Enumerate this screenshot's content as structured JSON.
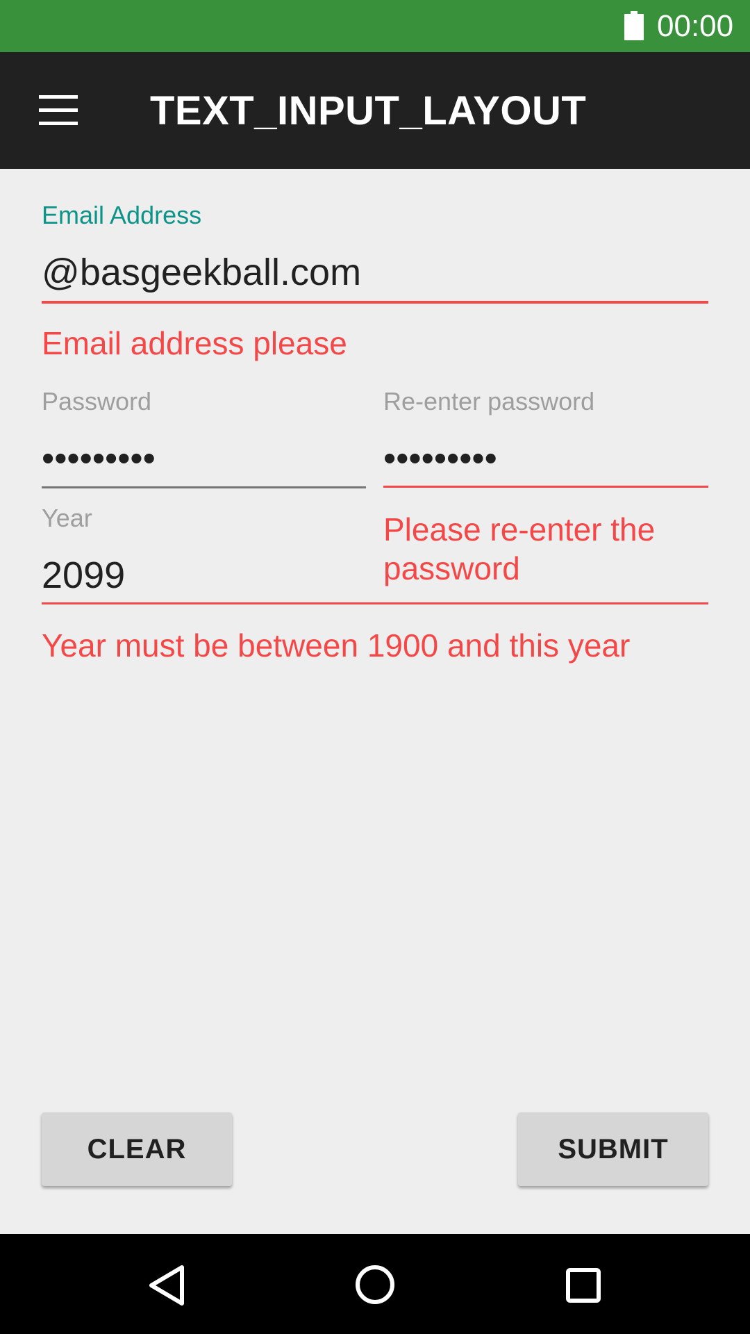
{
  "status_bar": {
    "time": "00:00",
    "battery_icon": "battery-full-icon",
    "color": "#3a913c"
  },
  "toolbar": {
    "title": "TEXT_INPUT_LAYOUT",
    "menu_icon": "hamburger-menu-icon",
    "color": "#212121"
  },
  "form": {
    "email": {
      "label": "Email Address",
      "value": "@basgeekball.com",
      "error": "Email address please"
    },
    "password": {
      "label": "Password",
      "value": "•••••••••"
    },
    "reenter_password": {
      "label": "Re-enter password",
      "value": "•••••••••",
      "error": "Please re-enter the password"
    },
    "year": {
      "label": "Year",
      "value": "2099",
      "error": "Year must be between 1900 and this year"
    }
  },
  "buttons": {
    "clear": "CLEAR",
    "submit": "SUBMIT"
  },
  "nav_bar": {
    "back_icon": "back-triangle-icon",
    "home_icon": "home-circle-icon",
    "recents_icon": "recents-square-icon"
  },
  "colors": {
    "accent": "#0d9488",
    "error": "#f44848",
    "background": "#eeeeee"
  }
}
